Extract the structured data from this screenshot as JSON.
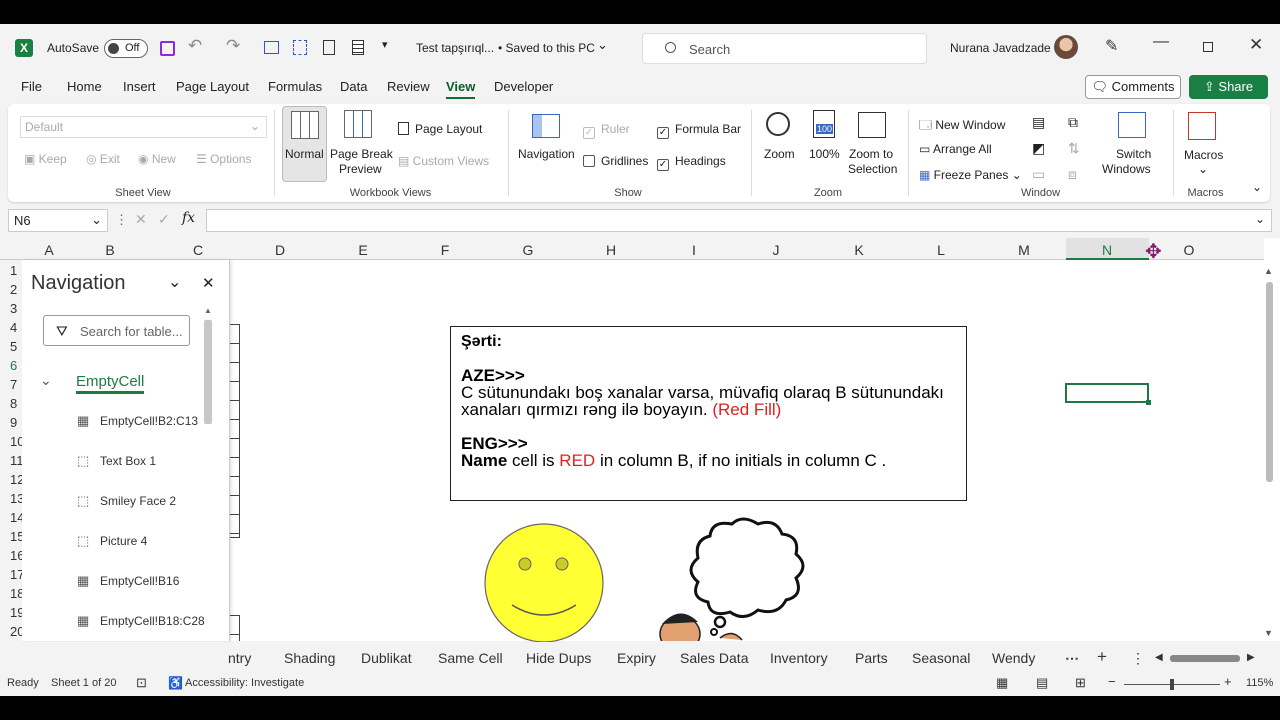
{
  "titlebar": {
    "autosave_label": "AutoSave",
    "autosave_state": "Off",
    "doc_title": "Test tapşırıql...",
    "save_status": "• Saved to this PC",
    "search_placeholder": "Search",
    "user_name": "Nurana Javadzade"
  },
  "menu_tabs": [
    "File",
    "Home",
    "Insert",
    "Page Layout",
    "Formulas",
    "Data",
    "Review",
    "View",
    "Developer"
  ],
  "active_tab": "View",
  "comments_label": "Comments",
  "share_label": "Share",
  "ribbon": {
    "sheet_view": {
      "dropdown": "Default",
      "keep": "Keep",
      "exit": "Exit",
      "new": "New",
      "options": "Options",
      "label": "Sheet View"
    },
    "workbook_views": {
      "normal": "Normal",
      "page_break_1": "Page Break",
      "page_break_2": "Preview",
      "page_layout": "Page Layout",
      "custom_views": "Custom Views",
      "label": "Workbook Views"
    },
    "show": {
      "navigation": "Navigation",
      "ruler": "Ruler",
      "formula_bar": "Formula Bar",
      "gridlines": "Gridlines",
      "headings": "Headings",
      "label": "Show"
    },
    "zoom": {
      "zoom": "Zoom",
      "pct": "100%",
      "zoom_sel_1": "Zoom to",
      "zoom_sel_2": "Selection",
      "label": "Zoom"
    },
    "window": {
      "new_window": "New Window",
      "arrange_all": "Arrange All",
      "freeze_panes": "Freeze Panes",
      "switch_1": "Switch",
      "switch_2": "Windows",
      "label": "Window"
    },
    "macros": {
      "macros": "Macros",
      "label": "Macros"
    }
  },
  "formula_bar": {
    "name_box": "N6",
    "fx": "fx",
    "value": ""
  },
  "columns": [
    "A",
    "B",
    "C",
    "D",
    "E",
    "F",
    "G",
    "H",
    "I",
    "J",
    "K",
    "L",
    "M",
    "N",
    "O"
  ],
  "rows": [
    "1",
    "2",
    "3",
    "4",
    "5",
    "6",
    "7",
    "8",
    "9",
    "10",
    "11",
    "12",
    "13",
    "14",
    "15",
    "16",
    "17",
    "18",
    "19",
    "20"
  ],
  "navigation_pane": {
    "title": "Navigation",
    "search_placeholder": "Search for table...",
    "root": "EmptyCell",
    "items": [
      {
        "label": "EmptyCell!B2:C13",
        "icon": "table-icon"
      },
      {
        "label": "Text Box 1",
        "icon": "shape-icon"
      },
      {
        "label": "Smiley Face 2",
        "icon": "shape-icon"
      },
      {
        "label": "Picture 4",
        "icon": "shape-icon"
      },
      {
        "label": "EmptyCell!B16",
        "icon": "table-icon"
      },
      {
        "label": "EmptyCell!B18:C28",
        "icon": "table-icon"
      }
    ]
  },
  "textbox": {
    "heading": "Şərti:",
    "aze_label": "AZE>>>",
    "aze_text": "C sütunundakı boş xanalar varsa, müvafiq olaraq B sütunundakı xanaları qırmızı rəng ilə boyayın.",
    "aze_red": "(Red Fill)",
    "eng_label": "ENG>>>",
    "eng_name": "Name",
    "eng_t1": "cell is",
    "eng_red": "RED",
    "eng_t2": "in column B, if no initials in column C ."
  },
  "sheet_tabs": [
    "ntry",
    "Shading",
    "Dublikat",
    "Same Cell",
    "Hide Dups",
    "Expiry",
    "Sales Data",
    "Inventory",
    "Parts",
    "Seasonal",
    "Wendy"
  ],
  "status": {
    "ready": "Ready",
    "sheet_of": "Sheet 1 of 20",
    "accessibility": "Accessibility: Investigate",
    "zoom": "115%"
  },
  "colors": {
    "excel_green": "#1a7f42",
    "red_text": "#e02020",
    "smiley": "#ffff33"
  }
}
